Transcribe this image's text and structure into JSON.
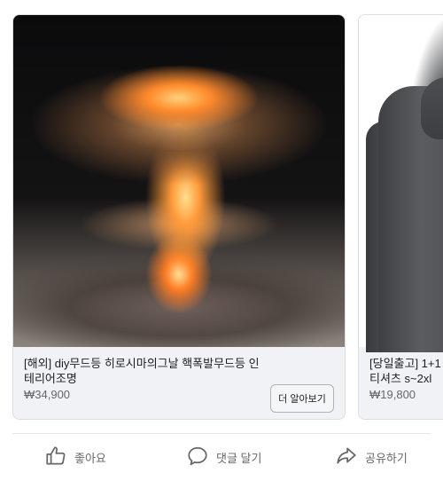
{
  "cards": [
    {
      "title": "[해외] diy무드등 히로시마의그날 핵폭발무드등 인테리어조명",
      "price": "₩34,900",
      "cta": "더 알아보기"
    },
    {
      "title": "[당일출고] 1+1",
      "title_line2": "티셔츠 s~2xl",
      "price": "₩19,800"
    }
  ],
  "actions": {
    "like": "좋아요",
    "comment": "댓글 달기",
    "share": "공유하기"
  },
  "icons": {
    "like": "thumbs-up-icon",
    "comment": "comment-bubble-icon",
    "share": "share-arrow-icon"
  }
}
